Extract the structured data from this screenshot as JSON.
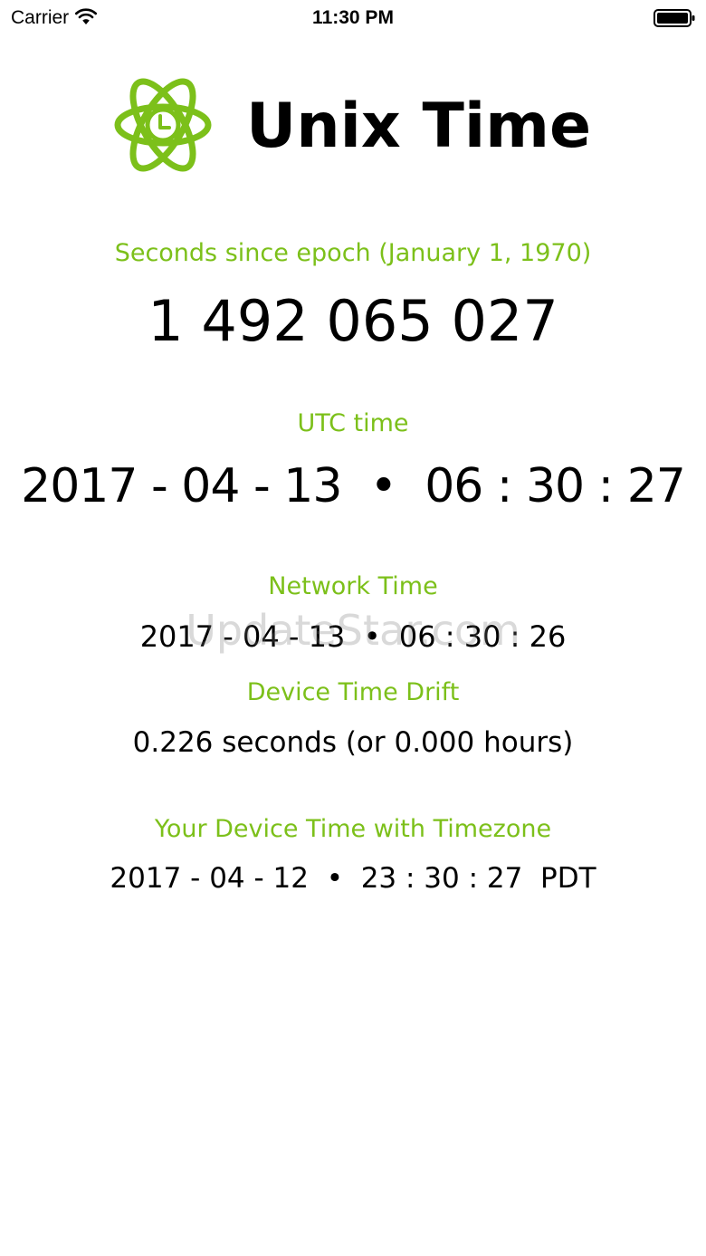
{
  "status_bar": {
    "carrier": "Carrier",
    "time": "11:30 PM",
    "wifi_icon": "wifi-icon",
    "battery_icon": "battery-icon"
  },
  "header": {
    "title": "Unix Time",
    "logo_icon": "atom-clock-icon"
  },
  "epoch": {
    "label": "Seconds since epoch (January 1, 1970)",
    "value": "1 492 065 027"
  },
  "utc": {
    "label": "UTC time",
    "value": "2017 - 04 - 13  •  06 : 30 : 27"
  },
  "network": {
    "label": "Network Time",
    "value": "2017 - 04 - 13  •  06 : 30 : 26"
  },
  "drift": {
    "label": "Device Time Drift",
    "value": "0.226 seconds (or 0.000 hours)"
  },
  "device": {
    "label": "Your Device Time with Timezone",
    "value": "2017 - 04 - 12  •  23 : 30 : 27  PDT"
  },
  "watermark": {
    "text": "UpdateStar.com"
  },
  "colors": {
    "accent": "#7cc01a",
    "text": "#000000",
    "background": "#ffffff"
  }
}
